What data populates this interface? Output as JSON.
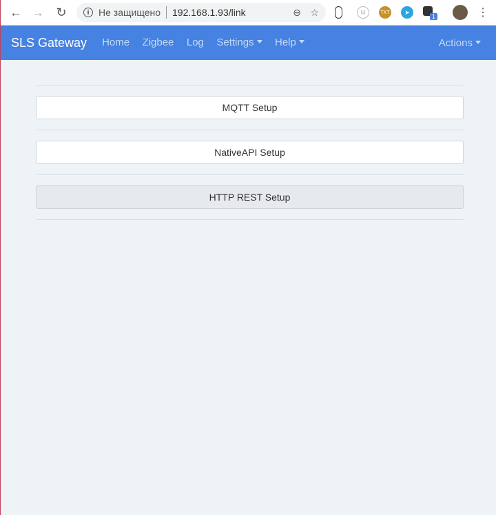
{
  "browser": {
    "not_secure": "Не защищено",
    "url": "192.168.1.93/link",
    "ext_badge": "1"
  },
  "navbar": {
    "brand": "SLS Gateway",
    "items": [
      {
        "label": "Home"
      },
      {
        "label": "Zigbee"
      },
      {
        "label": "Log"
      },
      {
        "label": "Settings"
      },
      {
        "label": "Help"
      }
    ],
    "actions": "Actions",
    "color": "#4582e1"
  },
  "buttons": [
    {
      "label": "MQTT Setup"
    },
    {
      "label": "NativeAPI Setup"
    },
    {
      "label": "HTTP REST Setup",
      "active": true
    }
  ]
}
